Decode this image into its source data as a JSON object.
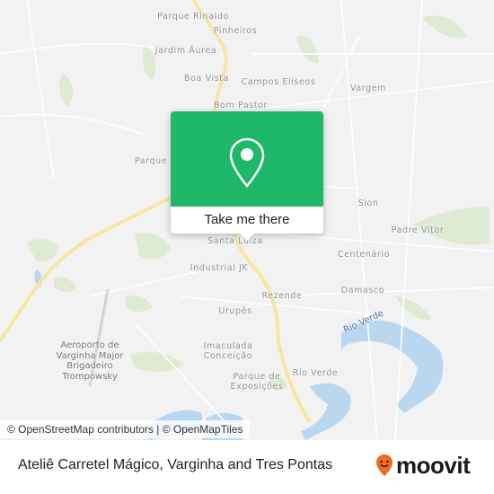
{
  "map": {
    "area_labels": [
      {
        "text": "Parque Rinaldo",
        "type": "neighborhood"
      },
      {
        "text": "Pinheiros",
        "type": "neighborhood"
      },
      {
        "text": "Jardim Áurea",
        "type": "neighborhood"
      },
      {
        "text": "Boa Vista",
        "type": "neighborhood"
      },
      {
        "text": "Campos Elíseos",
        "type": "neighborhood"
      },
      {
        "text": "Vargem",
        "type": "neighborhood"
      },
      {
        "text": "Bom Pastor",
        "type": "neighborhood"
      },
      {
        "text": "Parque",
        "type": "neighborhood"
      },
      {
        "text": "Sion",
        "type": "neighborhood"
      },
      {
        "text": "Padre Vitor",
        "type": "neighborhood"
      },
      {
        "text": "Santa Luíza",
        "type": "neighborhood"
      },
      {
        "text": "Centenário",
        "type": "neighborhood"
      },
      {
        "text": "Industrial JK",
        "type": "neighborhood"
      },
      {
        "text": "Rezende",
        "type": "neighborhood"
      },
      {
        "text": "Damasco",
        "type": "neighborhood"
      },
      {
        "text": "Urupês",
        "type": "neighborhood"
      },
      {
        "text": "Imaculada Conceição",
        "type": "neighborhood"
      },
      {
        "text": "Rio Verde",
        "type": "neighborhood"
      },
      {
        "text": "Parque de Exposições",
        "type": "neighborhood"
      },
      {
        "text": "Aeroporto de Varginha Major Brigadeiro Trompowsky",
        "type": "poi"
      },
      {
        "text": "Rio Verde",
        "type": "river"
      }
    ],
    "popup": {
      "icon": "map-pin-icon",
      "button_label": "Take me there",
      "color": "#1fb86b"
    },
    "attribution": "© OpenStreetMap contributors | © OpenMapTiles"
  },
  "footer": {
    "title": "Ateliê Carretel Mágico, Varginha and Tres Pontas",
    "logo_text": "moovit",
    "logo_icon": "moovit-pin-icon",
    "logo_color": "#f26a21"
  }
}
